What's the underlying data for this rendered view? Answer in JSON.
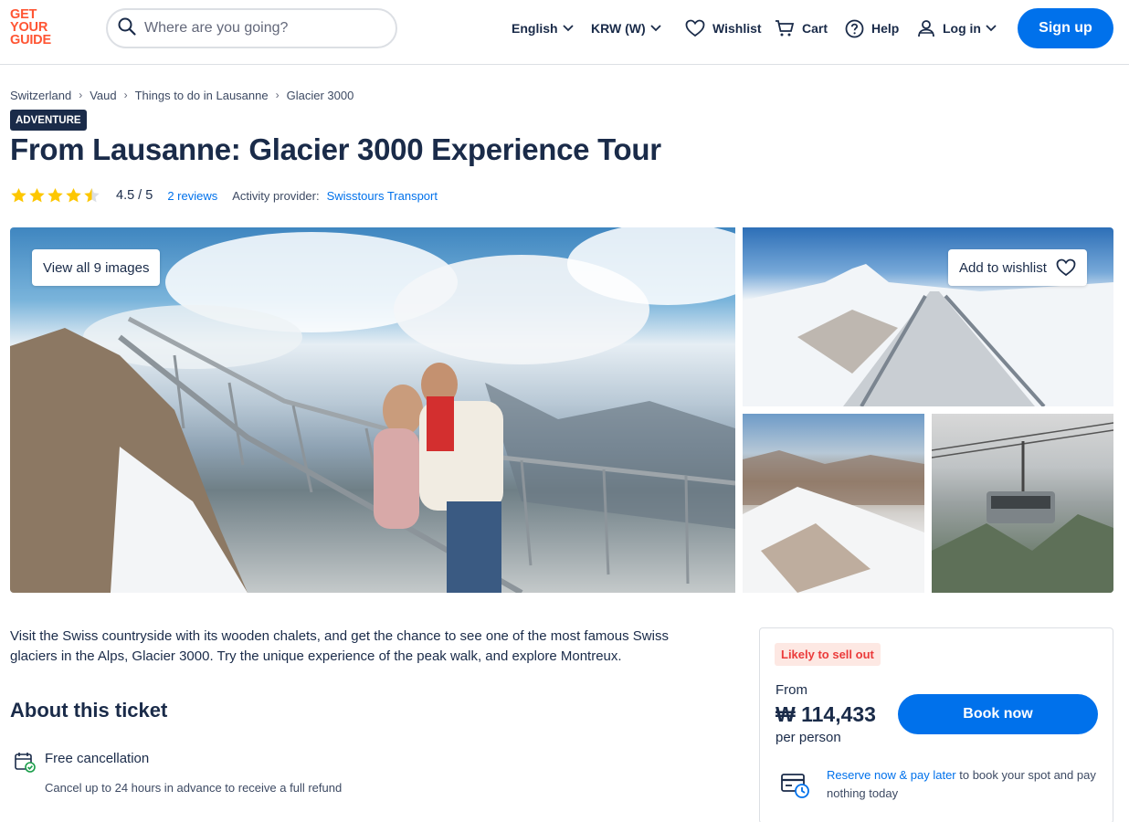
{
  "header": {
    "logo_lines": [
      "GET",
      "YOUR",
      "GUIDE"
    ],
    "search_placeholder": "Where are you going?",
    "language": "English",
    "currency": "KRW (W)",
    "wishlist": "Wishlist",
    "cart": "Cart",
    "help": "Help",
    "login": "Log in",
    "signup": "Sign up"
  },
  "breadcrumb": [
    "Switzerland",
    "Vaud",
    "Things to do in Lausanne",
    "Glacier 3000"
  ],
  "badge": "ADVENTURE",
  "title": "From Lausanne: Glacier 3000 Experience Tour",
  "rating": {
    "value": "4.5 / 5",
    "stars": 4.5,
    "reviews": "2 reviews",
    "provider_label": "Activity provider:",
    "provider": "Swisstours Transport"
  },
  "gallery": {
    "view_all": "View all 9 images",
    "add_wishlist": "Add to wishlist"
  },
  "description": "Visit the Swiss countryside with its wooden chalets, and get the chance to see one of the most famous Swiss glaciers in the Alps, Glacier 3000. Try the unique experience of the peak walk, and explore Montreux.",
  "about": {
    "heading": "About this ticket",
    "free_cancellation": "Free cancellation",
    "free_cancellation_sub": "Cancel up to 24 hours in advance to receive a full refund"
  },
  "booking": {
    "likely": "Likely to sell out",
    "from": "From",
    "price": "₩ 114,433",
    "per_person": "per person",
    "book_now": "Book now",
    "reserve_link": "Reserve now & pay later",
    "reserve_rest": " to book your spot and pay nothing today"
  },
  "colors": {
    "brand": "#ff5533",
    "primary": "#0071eb",
    "text": "#1a2b49",
    "star": "#fdc700"
  }
}
